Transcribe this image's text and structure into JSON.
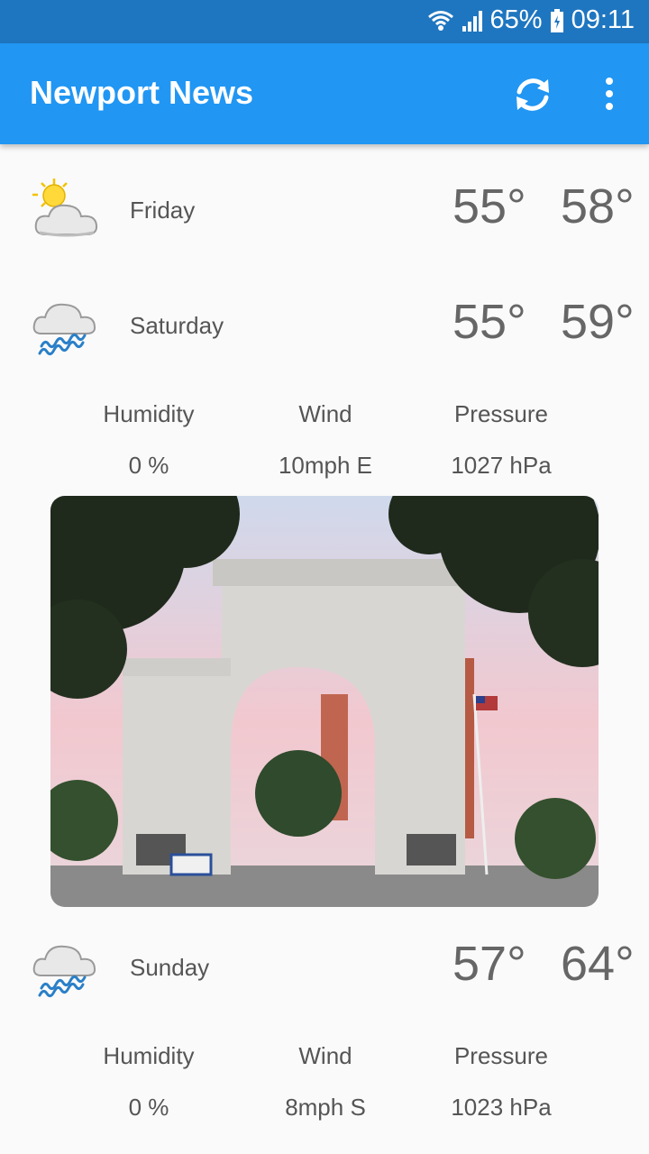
{
  "status": {
    "battery": "65%",
    "time": "09:11"
  },
  "appbar": {
    "title": "Newport News"
  },
  "forecast": [
    {
      "day": "Friday",
      "low": "55°",
      "high": "58°",
      "icon": "partly-cloudy-icon"
    },
    {
      "day": "Saturday",
      "low": "55°",
      "high": "59°",
      "icon": "rain-cloud-icon",
      "details": {
        "humidity_label": "Humidity",
        "humidity": "0 %",
        "wind_label": "Wind",
        "wind": "10mph E",
        "pressure_label": "Pressure",
        "pressure": "1027 hPa"
      }
    },
    {
      "day": "Sunday",
      "low": "57°",
      "high": "64°",
      "icon": "rain-cloud-icon",
      "details": {
        "humidity_label": "Humidity",
        "humidity": "0 %",
        "wind_label": "Wind",
        "wind": "8mph S",
        "pressure_label": "Pressure",
        "pressure": "1023 hPa"
      }
    }
  ],
  "colors": {
    "appbar": "#2196f3",
    "statusbar": "#1f76c0",
    "background": "#fafafa"
  }
}
